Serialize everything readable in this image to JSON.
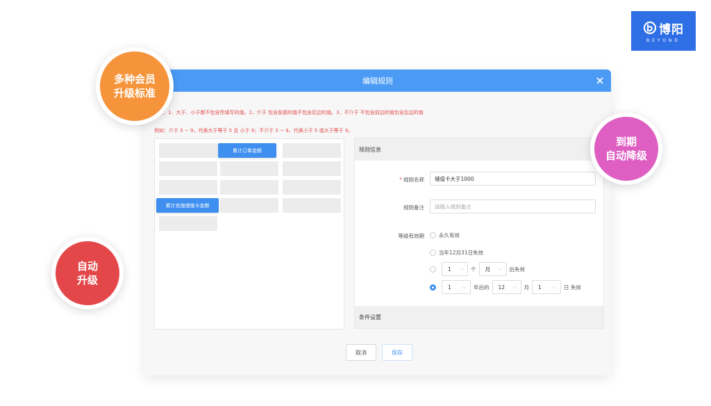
{
  "logo": {
    "brand": "博阳",
    "sub": "BEYOND"
  },
  "dialog": {
    "title": "编辑规则",
    "notice_1": "注：1、大于、小于都不包含所填写的值。2、介于 包含前面的值不包含后边的值。3、不介于 不包含前边的值包含后边的值",
    "notice_2": "例如：介于 5 ~ 9，代表大于等于 5 且 小于 9；不介于 5 ~ 9，代表小于 5 或大于等于 9。",
    "tiles": {
      "order_amount": "累计订单金额",
      "stored_value": "累计充值储值卡金额"
    },
    "rule_info_label": "规则信息",
    "condition_label": "条件设置",
    "form": {
      "name_label": "规则名称",
      "name_value": "储值卡大于1000",
      "remark_label": "规则备注",
      "remark_placeholder": "请输入规则备注",
      "validity_label": "等级有效期",
      "opt_forever": "永久有效",
      "opt_year_end": "当年12月31日失效",
      "opt_after": {
        "num": "1",
        "unit_label": "个",
        "unit_value": "月",
        "suffix": "后失效"
      },
      "opt_date": {
        "years": "1",
        "years_suffix": "年后的",
        "month": "12",
        "month_suffix": "月",
        "day": "1",
        "day_suffix": "日 失效"
      }
    },
    "buttons": {
      "cancel": "取消",
      "save": "保存"
    }
  },
  "bubbles": {
    "orange": [
      "多种会员",
      "升级标准"
    ],
    "pink": [
      "到期",
      "自动降级"
    ],
    "red": [
      "自动",
      "升级"
    ]
  },
  "colors": {
    "header_blue": "#4b9bf5",
    "accent_blue": "#3f8ff0",
    "notice_red": "#e24b4b",
    "bubble_orange": "#f6943b",
    "bubble_pink": "#de5ec2",
    "bubble_red": "#e4474a",
    "logo_blue": "#2f6fe6"
  }
}
